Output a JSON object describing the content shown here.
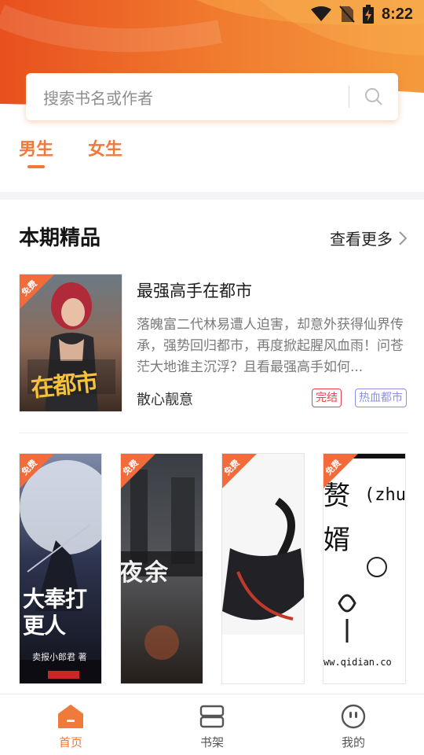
{
  "status_bar": {
    "time": "8:22",
    "icons": [
      "wifi-icon",
      "no-sim-icon",
      "battery-charging-icon"
    ]
  },
  "search": {
    "placeholder": "搜索书名或作者",
    "icon": "search-icon"
  },
  "tabs": [
    {
      "label": "男生",
      "active": true
    },
    {
      "label": "女生",
      "active": false
    }
  ],
  "section": {
    "title": "本期精品",
    "more_label": "查看更多"
  },
  "featured": {
    "badge": "免费",
    "cover_text": "在都市",
    "title": "最强高手在都市",
    "description": "落魄富二代林易遭人迫害，却意外获得仙界传承，强势回归都市，再度掀起腥风血雨！问苍茫大地谁主沉浮？且看最强高手如何...",
    "author": "散心靓意",
    "tags": [
      "完结",
      "热血都市"
    ]
  },
  "books": [
    {
      "badge": "免费",
      "cover_text": "大奉打更人",
      "cover_author": "卖报小郎君 著"
    },
    {
      "badge": "免费",
      "cover_text": "夜余"
    },
    {
      "badge": "免费",
      "cover_text": ""
    },
    {
      "badge": "免费",
      "cover_text": "赘婿",
      "cover_extra": "(zhu",
      "cover_url": "ww.qidian.co"
    }
  ],
  "nav": [
    {
      "label": "首页",
      "icon": "home-icon",
      "active": true
    },
    {
      "label": "书架",
      "icon": "bookshelf-icon",
      "active": false
    },
    {
      "label": "我的",
      "icon": "profile-icon",
      "active": false
    }
  ],
  "colors": {
    "accent": "#f07a3c",
    "tag_red": "#e8434c",
    "tag_blue": "#8a90e8"
  }
}
